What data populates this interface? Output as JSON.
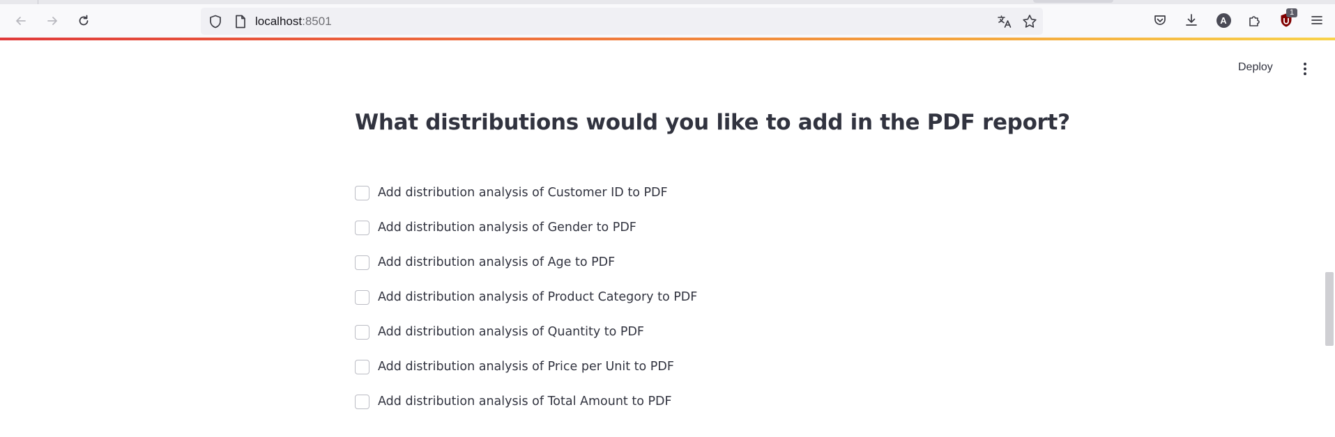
{
  "browser": {
    "url_host": "localhost",
    "url_port": ":8501",
    "extension_badge": "1",
    "avatar_letter": "A"
  },
  "app": {
    "deploy_label": "Deploy",
    "heading": "What distributions would you like to add in the PDF report?",
    "checkboxes": [
      {
        "label": "Add distribution analysis of Customer ID to PDF",
        "checked": false
      },
      {
        "label": "Add distribution analysis of Gender to PDF",
        "checked": false
      },
      {
        "label": "Add distribution analysis of Age to PDF",
        "checked": false
      },
      {
        "label": "Add distribution analysis of Product Category to PDF",
        "checked": false
      },
      {
        "label": "Add distribution analysis of Quantity to PDF",
        "checked": false
      },
      {
        "label": "Add distribution analysis of Price per Unit to PDF",
        "checked": false
      },
      {
        "label": "Add distribution analysis of Total Amount to PDF",
        "checked": false
      }
    ]
  },
  "colors": {
    "text": "#31333f",
    "checkbox_border": "#bbbcc4",
    "progress_start": "#e03a3a",
    "progress_end": "#f8d24a"
  }
}
